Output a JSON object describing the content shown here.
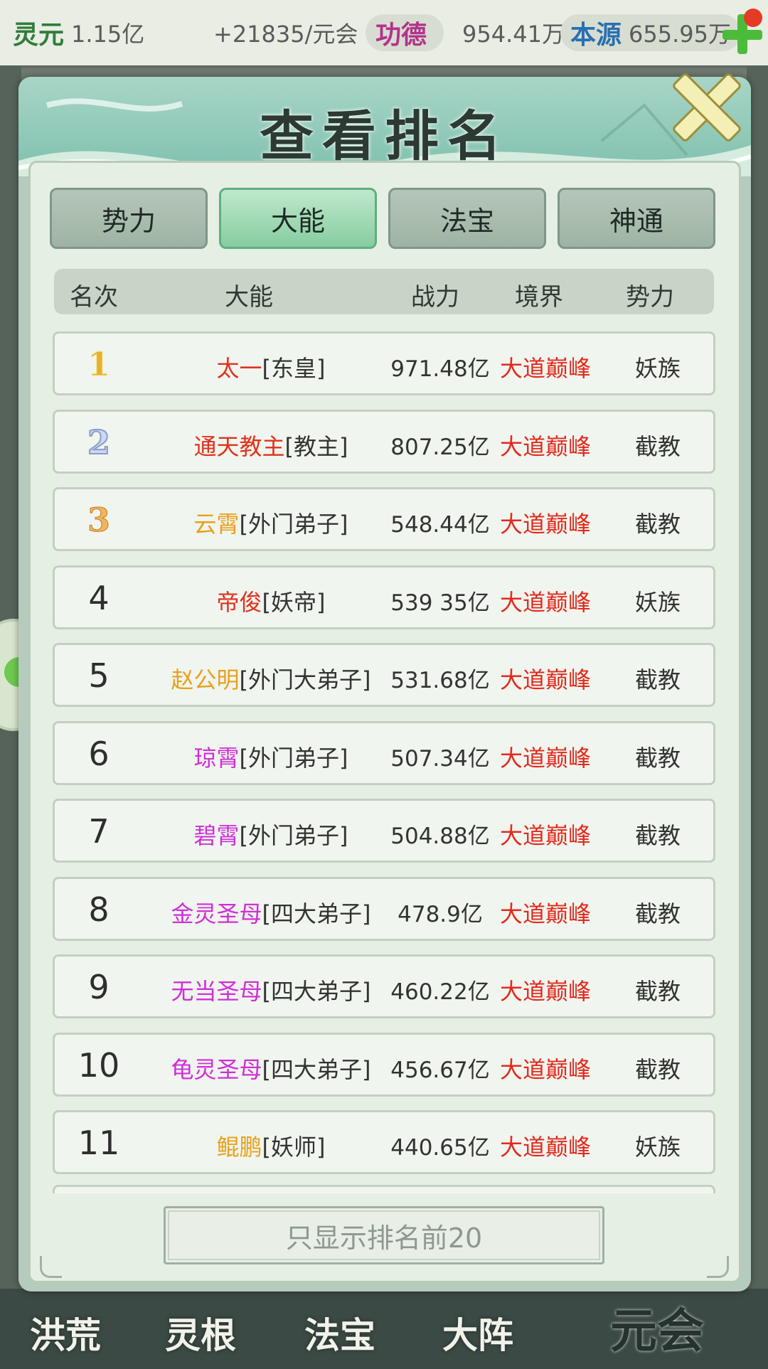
{
  "resources": [
    {
      "label": "灵元",
      "value": "1.15亿",
      "label_color": "#2f7d3a"
    },
    {
      "label": "",
      "value": "+21835/元会",
      "label_color": ""
    },
    {
      "label": "功德",
      "value": "954.41万",
      "label_color": "#b3338a"
    },
    {
      "label": "本源",
      "value": "655.95万",
      "label_color": "#2a6fb0"
    }
  ],
  "dialog": {
    "title": "查看排名",
    "tabs": [
      {
        "label": "势力",
        "active": false
      },
      {
        "label": "大能",
        "active": true
      },
      {
        "label": "法宝",
        "active": false
      },
      {
        "label": "神通",
        "active": false
      }
    ],
    "columns": [
      "名次",
      "大能",
      "战力",
      "境界",
      "势力"
    ],
    "rows": [
      {
        "rank": "1",
        "name": "太一",
        "name_color": "#e0321c",
        "title": "[东皇]",
        "power": "971.48亿",
        "realm": "大道巅峰",
        "faction": "妖族"
      },
      {
        "rank": "2",
        "name": "通天教主",
        "name_color": "#e0321c",
        "title": "[教主]",
        "power": "807.25亿",
        "realm": "大道巅峰",
        "faction": "截教"
      },
      {
        "rank": "3",
        "name": "云霄",
        "name_color": "#e8a11c",
        "title": "[外门弟子]",
        "power": "548.44亿",
        "realm": "大道巅峰",
        "faction": "截教"
      },
      {
        "rank": "4",
        "name": "帝俊",
        "name_color": "#e0321c",
        "title": "[妖帝]",
        "power": "539 35亿",
        "realm": "大道巅峰",
        "faction": "妖族"
      },
      {
        "rank": "5",
        "name": "赵公明",
        "name_color": "#e8a11c",
        "title": "[外门大弟子]",
        "power": "531.68亿",
        "realm": "大道巅峰",
        "faction": "截教"
      },
      {
        "rank": "6",
        "name": "琼霄",
        "name_color": "#d02fd8",
        "title": "[外门弟子]",
        "power": "507.34亿",
        "realm": "大道巅峰",
        "faction": "截教"
      },
      {
        "rank": "7",
        "name": "碧霄",
        "name_color": "#d02fd8",
        "title": "[外门弟子]",
        "power": "504.88亿",
        "realm": "大道巅峰",
        "faction": "截教"
      },
      {
        "rank": "8",
        "name": "金灵圣母",
        "name_color": "#d02fd8",
        "title": "[四大弟子]",
        "power": "478.9亿",
        "realm": "大道巅峰",
        "faction": "截教"
      },
      {
        "rank": "9",
        "name": "无当圣母",
        "name_color": "#d02fd8",
        "title": "[四大弟子]",
        "power": "460.22亿",
        "realm": "大道巅峰",
        "faction": "截教"
      },
      {
        "rank": "10",
        "name": "龟灵圣母",
        "name_color": "#d02fd8",
        "title": "[四大弟子]",
        "power": "456.67亿",
        "realm": "大道巅峰",
        "faction": "截教"
      },
      {
        "rank": "11",
        "name": "鲲鹏",
        "name_color": "#e8a11c",
        "title": "[妖师]",
        "power": "440.65亿",
        "realm": "大道巅峰",
        "faction": "妖族"
      }
    ],
    "filter_button": "只显示排名前20"
  },
  "bottom_nav": [
    "洪荒",
    "灵根",
    "法宝",
    "大阵",
    "元会"
  ],
  "icons": [
    "plus-icon",
    "close-icon"
  ]
}
